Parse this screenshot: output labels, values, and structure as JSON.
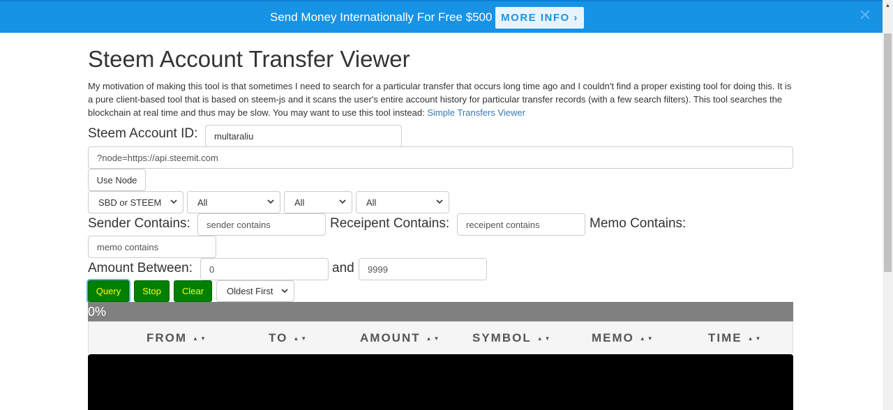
{
  "banner": {
    "text": "Send Money Internationally For Free $500",
    "button_label": "MORE INFO ›",
    "close_glyph": "✕"
  },
  "page": {
    "title": "Steem Account Transfer Viewer",
    "intro": "My motivation of making this tool is that sometimes I need to search for a particular transfer that occurs long time ago and I couldn't find a proper existing tool for doing this. It is a pure client-based tool that is based on steem-js and it scans the user's entire account history for particular transfer records (with a few search filters). This tool searches the blockchain at real time and thus may be slow. You may want to use this tool instead: ",
    "intro_link": "Simple Transfers Viewer"
  },
  "form": {
    "account_label": "Steem Account ID:",
    "account_value": "multaraliu",
    "node_placeholder": "?node=https://api.steemit.com",
    "use_node_label": "Use Node",
    "currency_select": "SBD or STEEM",
    "filter_select_1": "All",
    "filter_select_2": "All",
    "filter_select_3": "All",
    "sender_label": "Sender Contains:",
    "sender_placeholder": "sender contains",
    "receipent_label": "Receipent Contains:",
    "receipent_placeholder": "receipent contains",
    "memo_label": "Memo Contains:",
    "memo_placeholder": "memo contains",
    "amount_label": "Amount Between:",
    "amount_min": "0",
    "amount_and": "and",
    "amount_max": "9999",
    "query_label": "Query",
    "stop_label": "Stop",
    "clear_label": "Clear",
    "order_select": "Oldest First"
  },
  "progress": {
    "text": "0%",
    "value_percent": 0
  },
  "table": {
    "columns": [
      "FROM",
      "TO",
      "AMOUNT",
      "SYMBOL",
      "MEMO",
      "TIME"
    ],
    "sort_glyph": "▲▼"
  },
  "colors": {
    "banner": "#1793e6",
    "action_button": "#008000",
    "action_text": "#ffff00",
    "progress_bar": "#808080",
    "link": "#337ab7"
  }
}
